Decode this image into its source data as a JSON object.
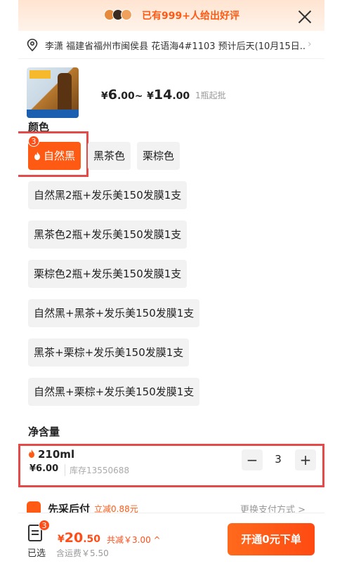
{
  "banner": {
    "text": "已有999+人给出好评"
  },
  "address": {
    "text": "李潇  福建省福州市闽侯县 花语海4#1103  预计后天(10月15日..."
  },
  "product": {
    "price_symbol": "¥",
    "price_min_int": "6",
    "price_min_dec": ".00",
    "price_sep": "~",
    "price_max_int": "14",
    "price_max_dec": ".00",
    "min_order": "1瓶起批"
  },
  "color_section": {
    "title": "颜色",
    "options": [
      {
        "label": "自然黑",
        "selected": true,
        "badge": "3"
      },
      {
        "label": "黑茶色"
      },
      {
        "label": "栗棕色"
      },
      {
        "label": "自然黑2瓶+发乐美150发膜1支"
      },
      {
        "label": "黑茶色2瓶+发乐美150发膜1支"
      },
      {
        "label": "栗棕色2瓶+发乐美150发膜1支"
      },
      {
        "label": "自然黑+黑茶+发乐美150发膜1支"
      },
      {
        "label": "黑茶+栗棕+发乐美150发膜1支"
      },
      {
        "label": "自然黑+栗棕+发乐美150发膜1支"
      }
    ]
  },
  "spec_section": {
    "title": "净含量",
    "name": "210ml",
    "price": "¥6.00",
    "stock": "库存13550688",
    "quantity": "3",
    "minus": "−",
    "plus": "+"
  },
  "peek_row": {
    "title": "先采后付",
    "tag": "立减0.88元",
    "right": "更换支付方式 >"
  },
  "bottom_bar": {
    "cart_label": "已选",
    "cart_badge": "3",
    "total_symbol": "¥",
    "total_int": "20",
    "total_dec": ".50",
    "discount": "共减￥3.00 ^",
    "shipping": "含运费￥5.50",
    "cta_label": "开通0元下单"
  },
  "colors": {
    "accent": "#ff5a14",
    "highlight_box": "#e34a4a"
  }
}
